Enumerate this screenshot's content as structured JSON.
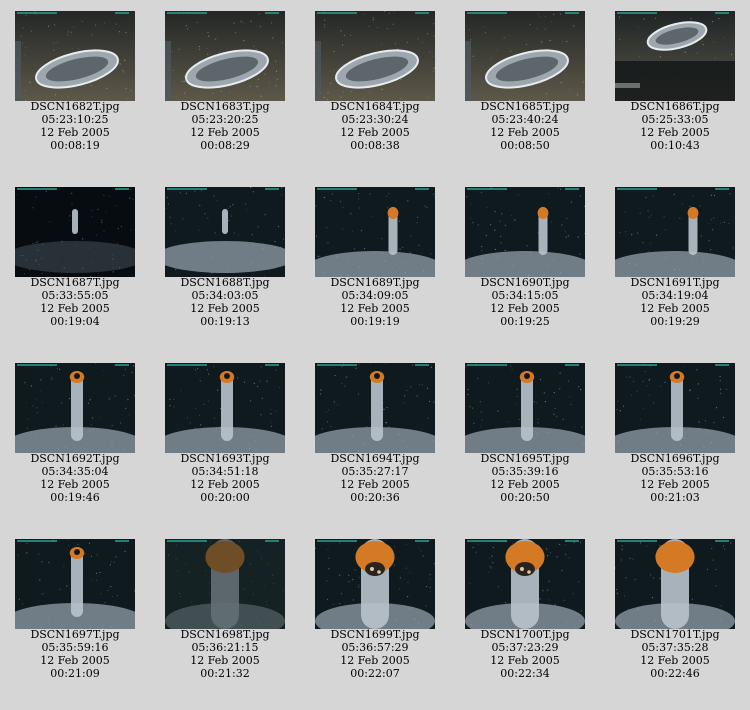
{
  "gallery": {
    "items": [
      {
        "filename": "DSCN1682T.jpg",
        "timecode": "05:23:10:25",
        "date": "12 Feb 2005",
        "elapsed": "00:08:19",
        "scene": "lava-pillow"
      },
      {
        "filename": "DSCN1683T.jpg",
        "timecode": "05:23:20:25",
        "date": "12 Feb 2005",
        "elapsed": "00:08:29",
        "scene": "lava-pillow"
      },
      {
        "filename": "DSCN1684T.jpg",
        "timecode": "05:23:30:24",
        "date": "12 Feb 2005",
        "elapsed": "00:08:38",
        "scene": "lava-pillow"
      },
      {
        "filename": "DSCN1685T.jpg",
        "timecode": "05:23:40:24",
        "date": "12 Feb 2005",
        "elapsed": "00:08:50",
        "scene": "lava-pillow"
      },
      {
        "filename": "DSCN1686T.jpg",
        "timecode": "05:25:33:05",
        "date": "12 Feb 2005",
        "elapsed": "00:10:43",
        "scene": "lava-pillow-shadow"
      },
      {
        "filename": "DSCN1687T.jpg",
        "timecode": "05:33:55:05",
        "date": "12 Feb 2005",
        "elapsed": "00:19:04",
        "scene": "chimney-far-dark"
      },
      {
        "filename": "DSCN1688T.jpg",
        "timecode": "05:34:03:05",
        "date": "12 Feb 2005",
        "elapsed": "00:19:13",
        "scene": "chimney-far"
      },
      {
        "filename": "DSCN1689T.jpg",
        "timecode": "05:34:09:05",
        "date": "12 Feb 2005",
        "elapsed": "00:19:19",
        "scene": "chimney-small"
      },
      {
        "filename": "DSCN1690T.jpg",
        "timecode": "05:34:15:05",
        "date": "12 Feb 2005",
        "elapsed": "00:19:25",
        "scene": "chimney-small"
      },
      {
        "filename": "DSCN1691T.jpg",
        "timecode": "05:34:19:04",
        "date": "12 Feb 2005",
        "elapsed": "00:19:29",
        "scene": "chimney-small"
      },
      {
        "filename": "DSCN1692T.jpg",
        "timecode": "05:34:35:04",
        "date": "12 Feb 2005",
        "elapsed": "00:19:46",
        "scene": "chimney-mid"
      },
      {
        "filename": "DSCN1693T.jpg",
        "timecode": "05:34:51:18",
        "date": "12 Feb 2005",
        "elapsed": "00:20:00",
        "scene": "chimney-mid"
      },
      {
        "filename": "DSCN1694T.jpg",
        "timecode": "05:35:27:17",
        "date": "12 Feb 2005",
        "elapsed": "00:20:36",
        "scene": "chimney-mid"
      },
      {
        "filename": "DSCN1695T.jpg",
        "timecode": "05:35:39:16",
        "date": "12 Feb 2005",
        "elapsed": "00:20:50",
        "scene": "chimney-mid"
      },
      {
        "filename": "DSCN1696T.jpg",
        "timecode": "05:35:53:16",
        "date": "12 Feb 2005",
        "elapsed": "00:21:03",
        "scene": "chimney-mid"
      },
      {
        "filename": "DSCN1697T.jpg",
        "timecode": "05:35:59:16",
        "date": "12 Feb 2005",
        "elapsed": "00:21:09",
        "scene": "chimney-mid"
      },
      {
        "filename": "DSCN1698T.jpg",
        "timecode": "05:36:21:15",
        "date": "12 Feb 2005",
        "elapsed": "00:21:32",
        "scene": "chimney-close-blur"
      },
      {
        "filename": "DSCN1699T.jpg",
        "timecode": "05:36:57:29",
        "date": "12 Feb 2005",
        "elapsed": "00:22:07",
        "scene": "chimney-top-close"
      },
      {
        "filename": "DSCN1700T.jpg",
        "timecode": "05:37:23:29",
        "date": "12 Feb 2005",
        "elapsed": "00:22:34",
        "scene": "chimney-top-close"
      },
      {
        "filename": "DSCN1701T.jpg",
        "timecode": "05:37:35:28",
        "date": "12 Feb 2005",
        "elapsed": "00:22:46",
        "scene": "chimney-tall-close"
      }
    ]
  },
  "colors": {
    "background": "#d6d6d6",
    "seafloor_dark": "#0b1214",
    "sediment": "#c9cfd6",
    "chimney_orange": "#d47a25",
    "overlay_text": "#2a9a8a"
  }
}
